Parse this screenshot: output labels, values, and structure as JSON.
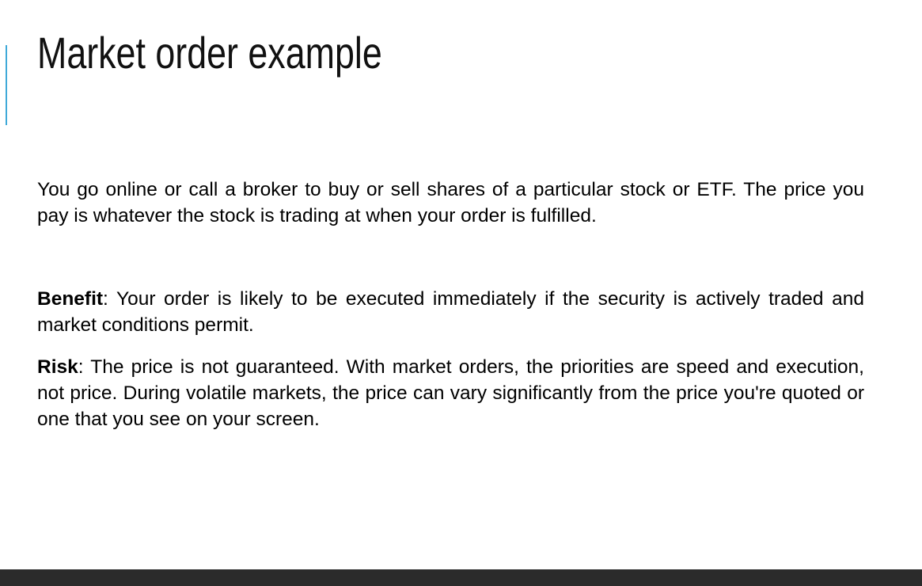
{
  "slide": {
    "title": "Market order example",
    "intro": "You go online or call a broker to buy or sell shares of a particular stock or ETF. The price you pay is whatever the stock is trading at when your order is fulfilled.",
    "benefit": {
      "term": "Benefit",
      "text": ": Your order is likely to be executed immediately if the security is actively traded and market conditions permit."
    },
    "risk": {
      "term": "Risk",
      "text": ": The price is not guaranteed. With market orders, the priorities are speed and execution, not price. During volatile markets, the price can vary significantly from the price you're quoted or one that you see on your screen."
    }
  },
  "colors": {
    "accent": "#3fa9d8",
    "footer": "#2b2b2b",
    "text": "#000000"
  }
}
